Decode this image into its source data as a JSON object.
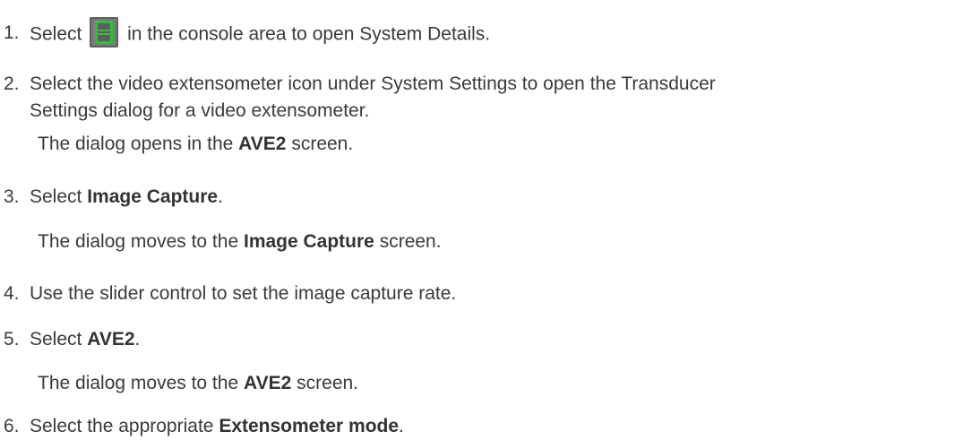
{
  "steps": [
    {
      "num": "1.",
      "pre": "Select",
      "post": "in the console area to open System Details.",
      "icon": "system-details-icon"
    },
    {
      "num": "2.",
      "line1": "Select the video extensometer icon under System Settings to open the Transducer",
      "line2": "Settings dialog for a video extensometer.",
      "result_pre": "The dialog opens in the",
      "result_bold": "AVE2",
      "result_post": "screen."
    },
    {
      "num": "3.",
      "pre": "Select",
      "bold": "Image Capture",
      "post": ".",
      "result_pre": "The dialog moves to the",
      "result_bold": "Image Capture",
      "result_post": "screen."
    },
    {
      "num": "4.",
      "text": "Use the slider control to set the image capture rate."
    },
    {
      "num": "5.",
      "pre": "Select",
      "bold": "AVE2",
      "post": ".",
      "result_pre": "The dialog moves to the",
      "result_bold": "AVE2",
      "result_post": "screen."
    },
    {
      "num": "6.",
      "pre": "Select the appropriate",
      "bold": "Extensometer mode",
      "post": "."
    }
  ],
  "colors": {
    "text": "#3a3a3a",
    "icon_bg": "#6a6a6a",
    "icon_green": "#2fbf3a"
  }
}
